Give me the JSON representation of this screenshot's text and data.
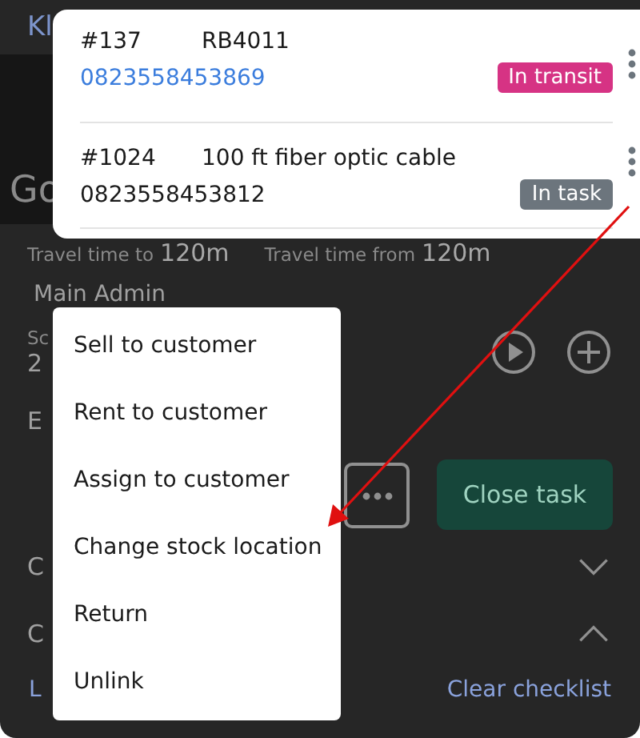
{
  "background": {
    "header_title": "Kl",
    "title": "Go",
    "travel_to_label": "Travel time to",
    "travel_to": "120m",
    "travel_from_label": "Travel time from",
    "travel_from": "120m",
    "assignee": "Main Admin",
    "schedule_label": "Sc",
    "schedule_value": "2",
    "section": "E",
    "close_button": "Close task",
    "sections": [
      {
        "label": "C",
        "expanded": false
      },
      {
        "label": "C",
        "expanded": true
      }
    ],
    "load_link": "L",
    "clear_link": "Clear checklist"
  },
  "items": [
    {
      "number": "#137",
      "name": "RB4011",
      "code": "0823558453869",
      "code_link": true,
      "status": "In transit",
      "color": "#d63384"
    },
    {
      "number": "#1024",
      "name": "100 ft fiber optic cable",
      "code": "0823558453812",
      "code_link": false,
      "status": "In task",
      "color": "#6c757d"
    }
  ],
  "menu": [
    "Sell to customer",
    "Rent to customer",
    "Assign to customer",
    "Change stock location",
    "Return",
    "Unlink"
  ]
}
